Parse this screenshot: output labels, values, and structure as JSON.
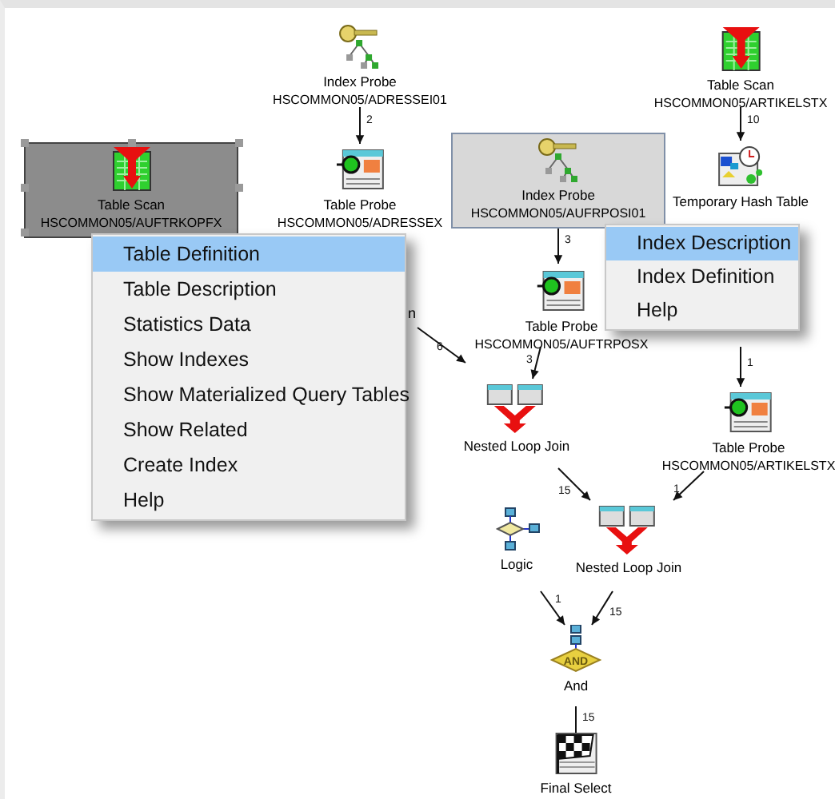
{
  "nodes": [
    {
      "kind": "index-probe",
      "title": "Index Probe",
      "subtitle": "HSCOMMON05/ADRESSEI01",
      "selected": false,
      "hovered": false
    },
    {
      "kind": "table-scan",
      "title": "Table Scan",
      "subtitle": "HSCOMMON05/ARTIKELSTX",
      "selected": false,
      "hovered": false
    },
    {
      "kind": "table-scan",
      "title": "Table Scan",
      "subtitle": "HSCOMMON05/AUFTRKOPFX",
      "selected": true,
      "hovered": false
    },
    {
      "kind": "table-probe",
      "title": "Table Probe",
      "subtitle": "HSCOMMON05/ADRESSEX",
      "selected": false,
      "hovered": false
    },
    {
      "kind": "index-probe",
      "title": "Index Probe",
      "subtitle": "HSCOMMON05/AUFRPOSI01",
      "selected": false,
      "hovered": true
    },
    {
      "kind": "hash-table",
      "title": "Temporary Hash Table",
      "selected": false,
      "hovered": false
    },
    {
      "kind": "table-probe",
      "title": "Table Probe",
      "subtitle": "HSCOMMON05/AUFTRPOSX",
      "selected": false,
      "hovered": false
    },
    {
      "kind": "nested-loop-join",
      "title": "Nested Loop Join",
      "selected": false,
      "hovered": false
    },
    {
      "kind": "table-probe",
      "title": "Table Probe",
      "subtitle": "HSCOMMON05/ARTIKELSTX",
      "selected": false,
      "hovered": false
    },
    {
      "kind": "logic",
      "title": "Logic",
      "selected": false,
      "hovered": false
    },
    {
      "kind": "nested-loop-join",
      "title": "Nested Loop Join",
      "selected": false,
      "hovered": false
    },
    {
      "kind": "and",
      "title": "And",
      "icon_text": "AND",
      "selected": false,
      "hovered": false
    },
    {
      "kind": "final-select",
      "title": "Final Select",
      "selected": false,
      "hovered": false
    }
  ],
  "partial_label": "n",
  "edges": [
    {
      "label": "2"
    },
    {
      "label": "10"
    },
    {
      "label": "3"
    },
    {
      "label": "3"
    },
    {
      "label": "6"
    },
    {
      "label": "1"
    },
    {
      "label": "15"
    },
    {
      "label": "1"
    },
    {
      "label": "1"
    },
    {
      "label": "15"
    },
    {
      "label": "15"
    }
  ],
  "table_menu": [
    {
      "label": "Table Definition",
      "selected": true
    },
    {
      "label": "Table Description",
      "selected": false
    },
    {
      "label": "Statistics Data",
      "selected": false
    },
    {
      "label": "Show Indexes",
      "selected": false
    },
    {
      "label": "Show Materialized Query Tables",
      "selected": false
    },
    {
      "label": "Show Related",
      "selected": false
    },
    {
      "label": "Create Index",
      "selected": false
    },
    {
      "label": "Help",
      "selected": false
    }
  ],
  "index_menu": [
    {
      "label": "Index Description",
      "selected": true
    },
    {
      "label": "Index Definition",
      "selected": false
    },
    {
      "label": "Help",
      "selected": false
    }
  ]
}
